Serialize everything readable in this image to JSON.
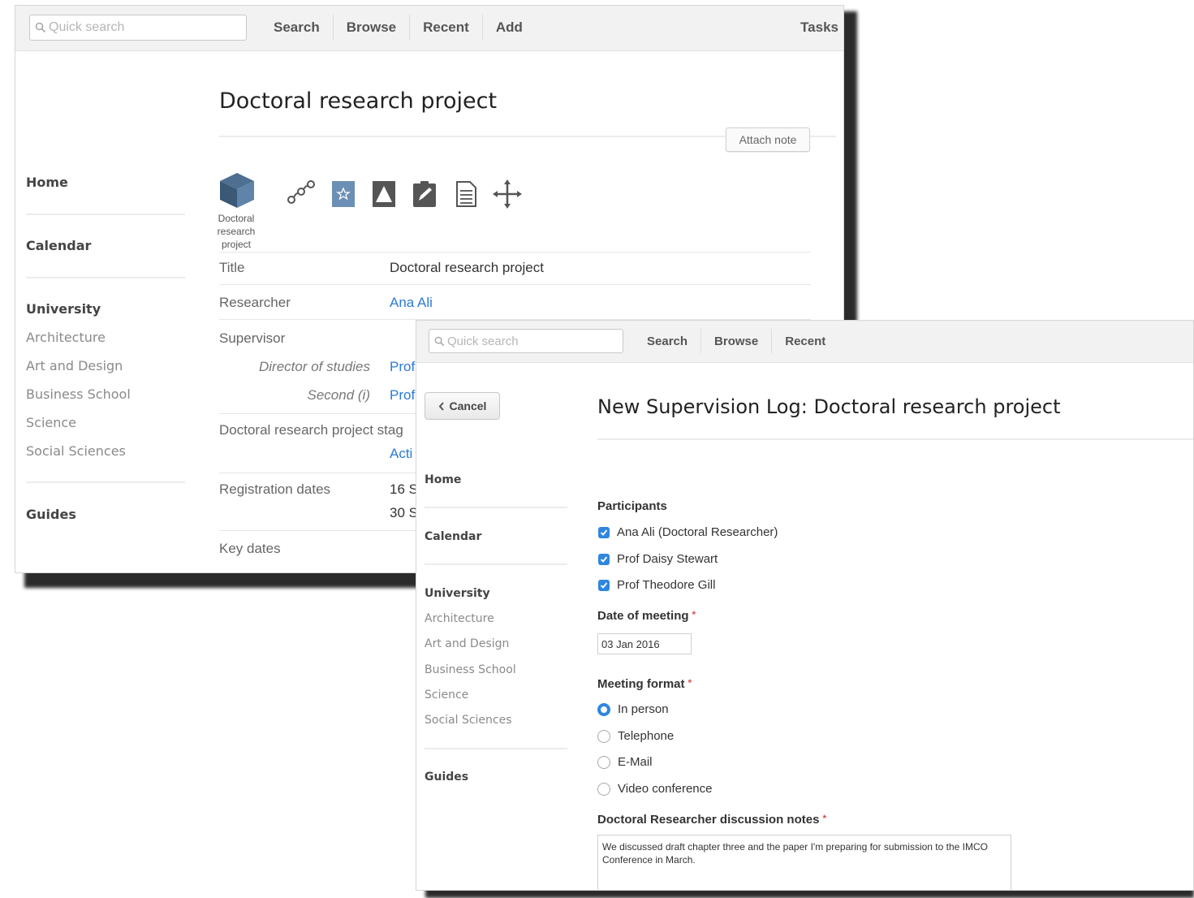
{
  "back": {
    "topbar": {
      "search_placeholder": "Quick search",
      "nav": [
        "Search",
        "Browse",
        "Recent",
        "Add"
      ],
      "tasks": "Tasks"
    },
    "sidebar": {
      "home": "Home",
      "calendar": "Calendar",
      "university": "University",
      "links": [
        "Architecture",
        "Art and Design",
        "Business School",
        "Science",
        "Social Sciences"
      ],
      "guides": "Guides"
    },
    "page_title": "Doctoral research project",
    "attach_note": "Attach note",
    "object_icon_label": "Doctoral research project",
    "fields": {
      "title_label": "Title",
      "title_value": "Doctoral research project",
      "researcher_label": "Researcher",
      "researcher_value": "Ana Ali",
      "supervisor_label": "Supervisor",
      "director_label": "Director of studies",
      "director_value": "Prof",
      "second_label": "Second (i)",
      "second_value": "Prof",
      "stage_label": "Doctoral research project stag",
      "stage_value": "Acti",
      "registration_label": "Registration dates",
      "registration_value_1": "16 S",
      "registration_value_2": "30 S",
      "key_dates_label": "Key dates"
    }
  },
  "front": {
    "topbar": {
      "search_placeholder": "Quick search",
      "nav": [
        "Search",
        "Browse",
        "Recent"
      ]
    },
    "cancel_label": "Cancel",
    "page_title": "New Supervision Log: Doctoral research project",
    "sidebar": {
      "home": "Home",
      "calendar": "Calendar",
      "university": "University",
      "links": [
        "Architecture",
        "Art and Design",
        "Business School",
        "Science",
        "Social Sciences"
      ],
      "guides": "Guides"
    },
    "participants_label": "Participants",
    "participants": [
      "Ana Ali (Doctoral Researcher)",
      "Prof Daisy Stewart",
      "Prof Theodore Gill"
    ],
    "date_label": "Date of meeting",
    "date_value": "03 Jan 2016",
    "format_label": "Meeting format",
    "formats": [
      "In person",
      "Telephone",
      "E-Mail",
      "Video conference"
    ],
    "format_selected": "In person",
    "notes_label": "Doctoral Researcher discussion notes",
    "notes_value": "We discussed draft chapter three and the paper I'm preparing for submission to the IMCO Conference in March.",
    "required_marker": "*",
    "colors": {
      "accent": "#2f86e0",
      "link": "#2b7bd6",
      "required": "#d9534f"
    }
  }
}
